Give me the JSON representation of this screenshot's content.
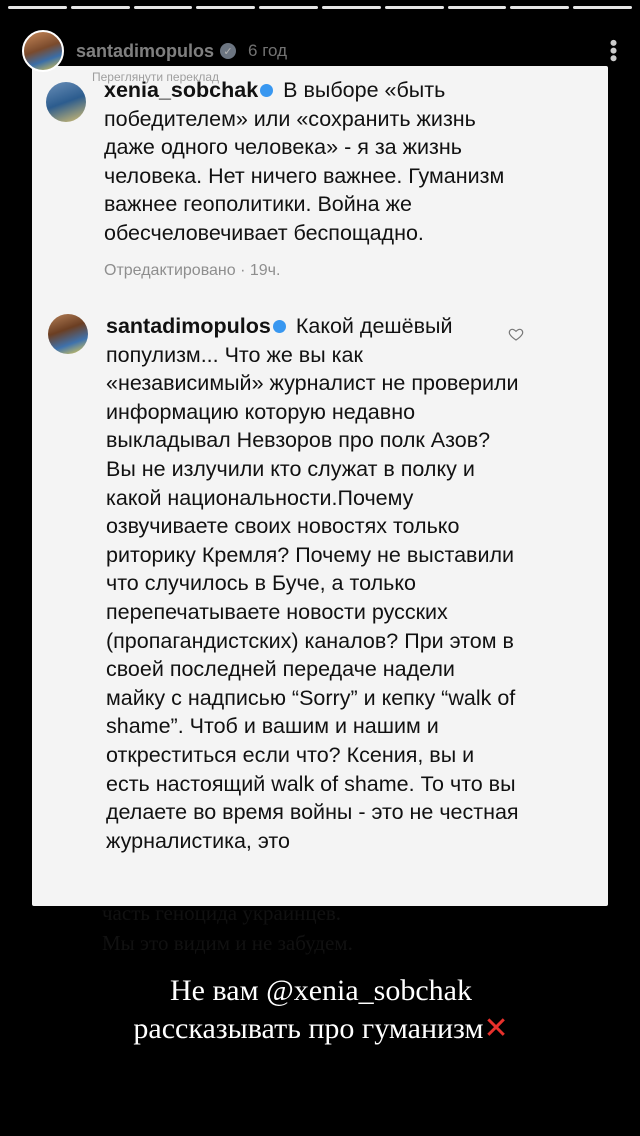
{
  "story": {
    "segments": 10,
    "author": "santadimopulos",
    "time": "6 год",
    "translate_label": "Переглянути переклад"
  },
  "comment1": {
    "username": "xenia_sobchak",
    "text": "В выборе «быть победителем» или «сохранить жизнь даже одного  человека» - я за жизнь человека. Нет ничего важнее. Гуманизм важнее геополитики. Война же обесчеловечивает беспощадно.",
    "meta": "Отредактировано · 19ч."
  },
  "comment2": {
    "username": "santadimopulos",
    "text": "Какой дешёвый популизм... Что же вы как «независимый» журналист не проверили информацию которую недавно выкладывал Невзоров про полк Азов? Вы не излучили кто служат в полку и какой национальности.Почему озвучиваете своих новостях только риторику Кремля? Почему не выставили что случилось в Буче, а только перепечатываете новости русских (пропагандистских) каналов? При этом в своей последней передаче надели майку с надписью “Sorry” и кепку “walk of shame”. Чтоб и вашим и нашим и откреститься если что? Ксения, вы и есть настоящий walk of shame. То что вы делаете во время войны - это не честная журналистика, это"
  },
  "handwritten": {
    "line1": "часть геноцида украинцев.",
    "line2": "Мы это видим и не забудем."
  },
  "caption": {
    "line1": "Не вам @xenia_sobchak",
    "line2": "рассказывать про гуманизм"
  },
  "icons": {
    "verified": "verified-badge-icon",
    "heart": "heart-icon",
    "more": "more-vertical-icon",
    "cross": "cross-mark-icon"
  },
  "colors": {
    "verified": "#3897f0",
    "cross": "#e8312c"
  }
}
